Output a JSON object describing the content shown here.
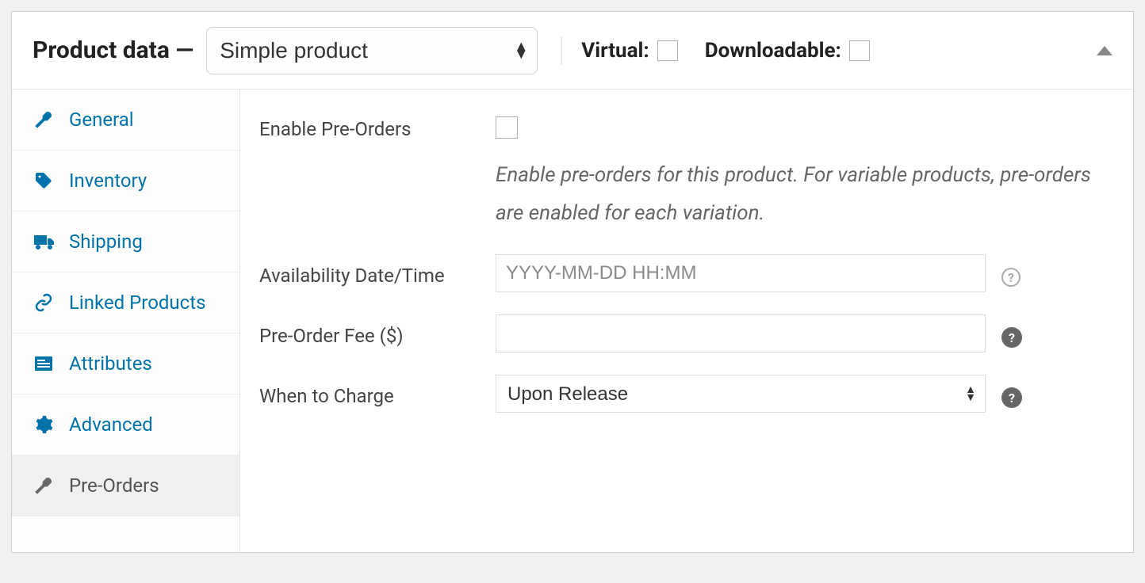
{
  "header": {
    "title": "Product data —",
    "product_type": "Simple product",
    "virtual_label": "Virtual:",
    "downloadable_label": "Downloadable:"
  },
  "tabs": [
    {
      "key": "general",
      "label": "General",
      "active": false
    },
    {
      "key": "inventory",
      "label": "Inventory",
      "active": false
    },
    {
      "key": "shipping",
      "label": "Shipping",
      "active": false
    },
    {
      "key": "linked",
      "label": "Linked Products",
      "active": false
    },
    {
      "key": "attributes",
      "label": "Attributes",
      "active": false
    },
    {
      "key": "advanced",
      "label": "Advanced",
      "active": false
    },
    {
      "key": "preorders",
      "label": "Pre-Orders",
      "active": true
    }
  ],
  "form": {
    "enable_label": "Enable Pre-Orders",
    "enable_desc": "Enable pre-orders for this product. For variable products, pre-orders are enabled for each variation.",
    "avail_label": "Availability Date/Time",
    "avail_placeholder": "YYYY-MM-DD HH:MM",
    "avail_value": "",
    "fee_label": "Pre-Order Fee ($)",
    "fee_value": "",
    "charge_label": "When to Charge",
    "charge_value": "Upon Release"
  }
}
